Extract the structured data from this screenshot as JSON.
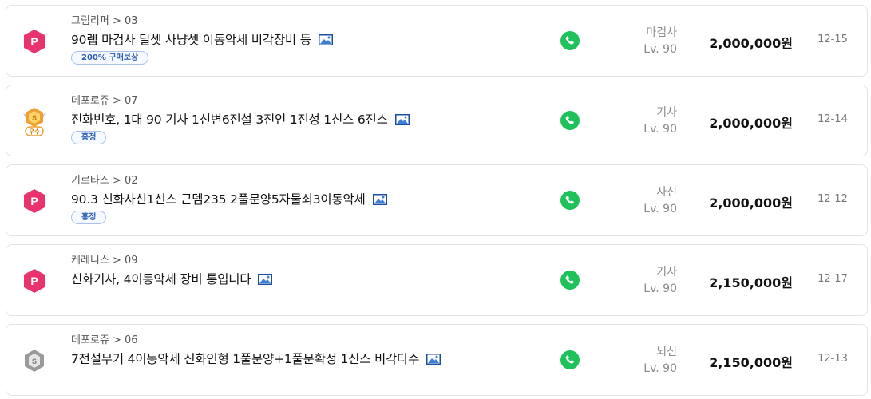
{
  "listings": [
    {
      "badge": "premium-p-icon",
      "breadcrumb": "그림리퍼 > 03",
      "title": "90렙 마검사 딜셋 사냥셋 이동악세 비각장비 등",
      "tag": "200% 구매보상",
      "class_name": "마검사",
      "level": "Lv. 90",
      "price": "2,000,000원",
      "date": "12-15"
    },
    {
      "badge": "excellent-seller-icon",
      "badge_text": "우수",
      "breadcrumb": "데포로쥬 > 07",
      "title": "전화번호, 1대 90 기사 1신변6전설 3전인 1전성 1신스 6전스",
      "tag": "흥정",
      "class_name": "기사",
      "level": "Lv. 90",
      "price": "2,000,000원",
      "date": "12-14"
    },
    {
      "badge": "premium-p-icon",
      "breadcrumb": "기르타스 > 02",
      "title": "90.3 신화사신1신스 근뎀235 2풀문양5자물쇠3이동악세",
      "tag": "흥정",
      "class_name": "사신",
      "level": "Lv. 90",
      "price": "2,000,000원",
      "date": "12-12"
    },
    {
      "badge": "premium-p-icon",
      "breadcrumb": "케레니스 > 09",
      "title": "신화기사, 4이동악세 장비 통입니다",
      "tag": "",
      "class_name": "기사",
      "level": "Lv. 90",
      "price": "2,150,000원",
      "date": "12-17"
    },
    {
      "badge": "gray-seller-icon",
      "breadcrumb": "데포로쥬 > 06",
      "title": "7전설무기 4이동악세 신화인형 1풀문양+1풀문확정 1신스 비각다수",
      "tag": "",
      "class_name": "뇌신",
      "level": "Lv. 90",
      "price": "2,150,000원",
      "date": "12-13"
    }
  ],
  "colors": {
    "premium": "#e8336d",
    "phone": "#1ec15a",
    "tag_text": "#2b5fb4",
    "excellent": "#f0a030",
    "gray_badge": "#9a9a9a"
  }
}
